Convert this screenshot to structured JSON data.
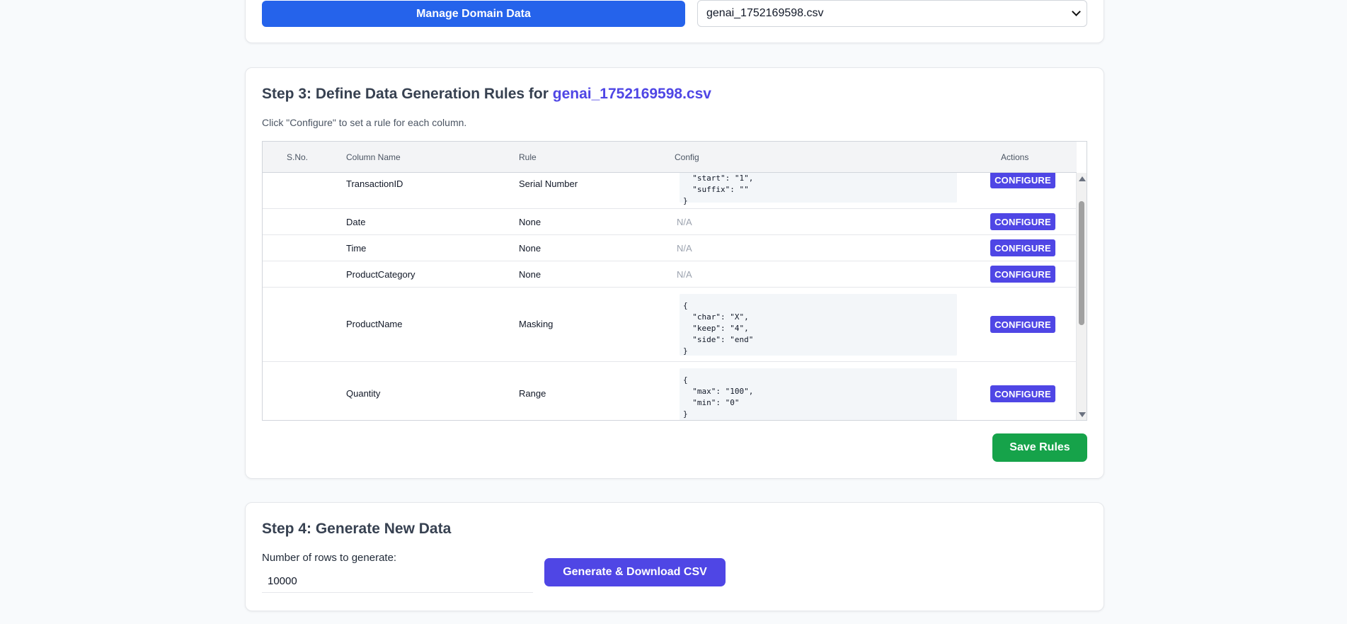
{
  "top": {
    "manage_label": "Manage Domain Data",
    "selected_file": "genai_1752169598.csv"
  },
  "step3": {
    "title_prefix": "Step 3: Define Data Generation Rules for ",
    "file_name": "genai_1752169598.csv",
    "hint": "Click \"Configure\" to set a rule for each column.",
    "headers": {
      "sno": "S.No.",
      "column": "Column Name",
      "rule": "Rule",
      "config": "Config",
      "actions": "Actions"
    },
    "rows": [
      {
        "column": "TransactionID",
        "rule": "Serial Number",
        "config": "  \"start\": \"1\",\n  \"suffix\": \"\"\n}",
        "action": "CONFIGURE"
      },
      {
        "column": "Date",
        "rule": "None",
        "config": "N/A",
        "action": "CONFIGURE"
      },
      {
        "column": "Time",
        "rule": "None",
        "config": "N/A",
        "action": "CONFIGURE"
      },
      {
        "column": "ProductCategory",
        "rule": "None",
        "config": "N/A",
        "action": "CONFIGURE"
      },
      {
        "column": "ProductName",
        "rule": "Masking",
        "config": "{\n  \"char\": \"X\",\n  \"keep\": \"4\",\n  \"side\": \"end\"\n}",
        "action": "CONFIGURE"
      },
      {
        "column": "Quantity",
        "rule": "Range",
        "config": "{\n  \"max\": \"100\",\n  \"min\": \"0\"\n}",
        "action": "CONFIGURE"
      }
    ],
    "save_label": "Save Rules"
  },
  "step4": {
    "title": "Step 4: Generate New Data",
    "rows_label": "Number of rows to generate:",
    "rows_value": "10000",
    "generate_label": "Generate & Download CSV"
  }
}
